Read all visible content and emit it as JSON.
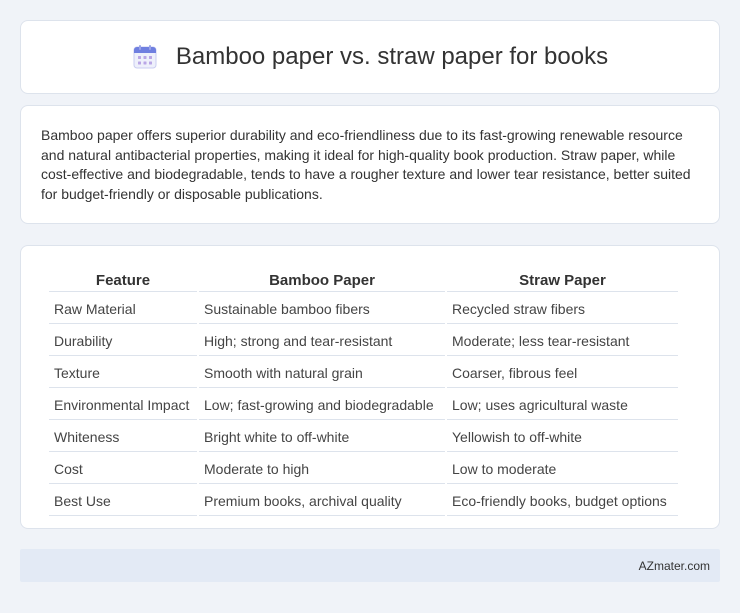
{
  "header": {
    "title": "Bamboo paper vs. straw paper for books",
    "icon": "calendar-icon"
  },
  "summary": {
    "text": "Bamboo paper offers superior durability and eco-friendliness due to its fast-growing renewable resource and natural antibacterial properties, making it ideal for high-quality book production. Straw paper, while cost-effective and biodegradable, tends to have a rougher texture and lower tear resistance, better suited for budget-friendly or disposable publications."
  },
  "table": {
    "headers": [
      "Feature",
      "Bamboo Paper",
      "Straw Paper"
    ],
    "rows": [
      [
        "Raw Material",
        "Sustainable bamboo fibers",
        "Recycled straw fibers"
      ],
      [
        "Durability",
        "High; strong and tear-resistant",
        "Moderate; less tear-resistant"
      ],
      [
        "Texture",
        "Smooth with natural grain",
        "Coarser, fibrous feel"
      ],
      [
        "Environmental Impact",
        "Low; fast-growing and biodegradable",
        "Low; uses agricultural waste"
      ],
      [
        "Whiteness",
        "Bright white to off-white",
        "Yellowish to off-white"
      ],
      [
        "Cost",
        "Moderate to high",
        "Low to moderate"
      ],
      [
        "Best Use",
        "Premium books, archival quality",
        "Eco-friendly books, budget options"
      ]
    ]
  },
  "footer": {
    "brand": "AZmater.com"
  }
}
